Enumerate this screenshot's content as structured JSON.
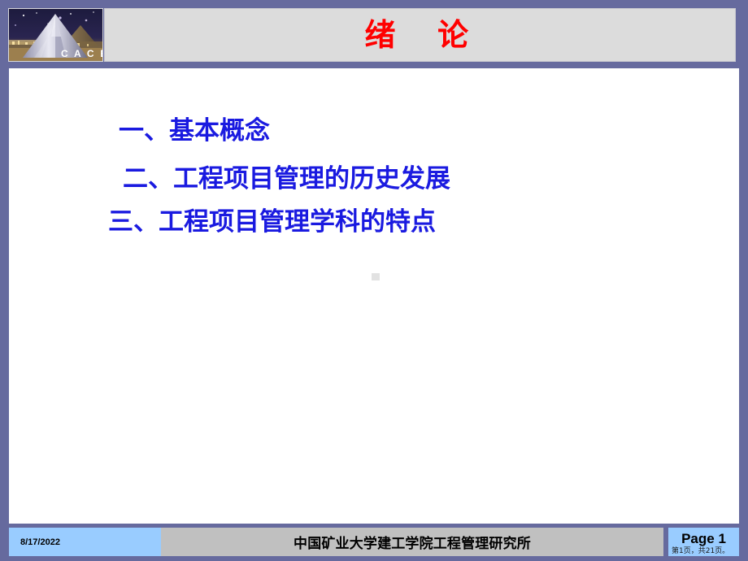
{
  "slide": {
    "title": "绪  论",
    "title_color": "#ff0000",
    "frame_color": "#666a9e",
    "title_panel_color": "#dcdcdc",
    "body_color": "#ffffff"
  },
  "logo": {
    "name": "cace-pyramid-logo",
    "caption": "C A C E"
  },
  "agenda": {
    "items": [
      {
        "label": "一、基本概念"
      },
      {
        "label": "二、工程项目管理的历史发展"
      },
      {
        "label": "三、工程项目管理学科的特点"
      }
    ],
    "text_color": "#1a1ae0"
  },
  "footer": {
    "date": "8/17/2022",
    "organization": "中国矿业大学建工学院工程管理研究所",
    "page_label": "Page 1",
    "page_sub": "第1页，共21页。",
    "date_bg": "#99ccff",
    "center_bg": "#c0c0c0",
    "page_bg": "#99ccff"
  }
}
